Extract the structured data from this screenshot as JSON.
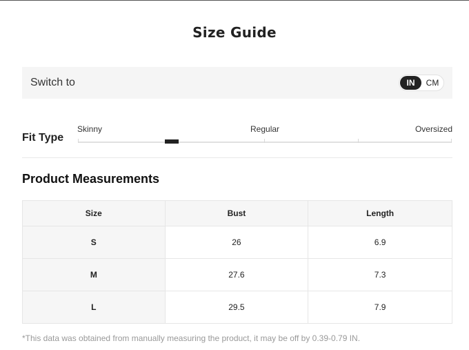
{
  "title": "Size Guide",
  "unit_switch": {
    "label": "Switch to",
    "options": [
      "IN",
      "CM"
    ],
    "selected": "IN"
  },
  "fit_type": {
    "label": "Fit Type",
    "options": [
      "Skinny",
      "Regular",
      "Oversized"
    ],
    "value_fraction": 0.25
  },
  "measurements": {
    "title": "Product Measurements",
    "headers": [
      "Size",
      "Bust",
      "Length"
    ],
    "rows": [
      [
        "S",
        "26",
        "6.9"
      ],
      [
        "M",
        "27.6",
        "7.3"
      ],
      [
        "L",
        "29.5",
        "7.9"
      ]
    ]
  },
  "note": "*This data was obtained from manually measuring the product, it may be off by 0.39-0.79 IN."
}
